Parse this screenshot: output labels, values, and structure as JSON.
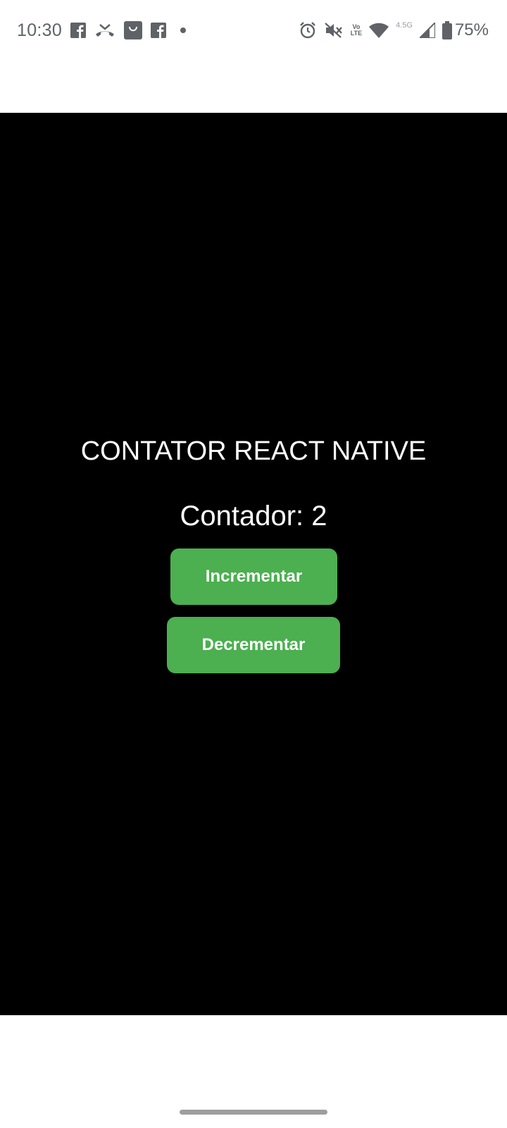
{
  "status_bar": {
    "time": "10:30",
    "battery_percent": "75%",
    "network_type": "4.5G",
    "volte_top": "Vo",
    "volte_bottom": "LTE",
    "notification_icons": [
      "facebook-icon",
      "missed-call-icon",
      "shopping-bag-icon",
      "facebook-icon",
      "dot-icon"
    ],
    "system_icons": [
      "alarm-icon",
      "vibrate-off-icon",
      "volte-icon",
      "wifi-icon",
      "signal-icon",
      "battery-icon"
    ]
  },
  "app": {
    "title": "CONTATOR REACT NATIVE",
    "counter_text": "Contador: 2",
    "increment_label": "Incrementar",
    "decrement_label": "Decrementar"
  },
  "colors": {
    "app_background": "#000000",
    "button_green": "#4caf50",
    "text_white": "#ffffff"
  }
}
